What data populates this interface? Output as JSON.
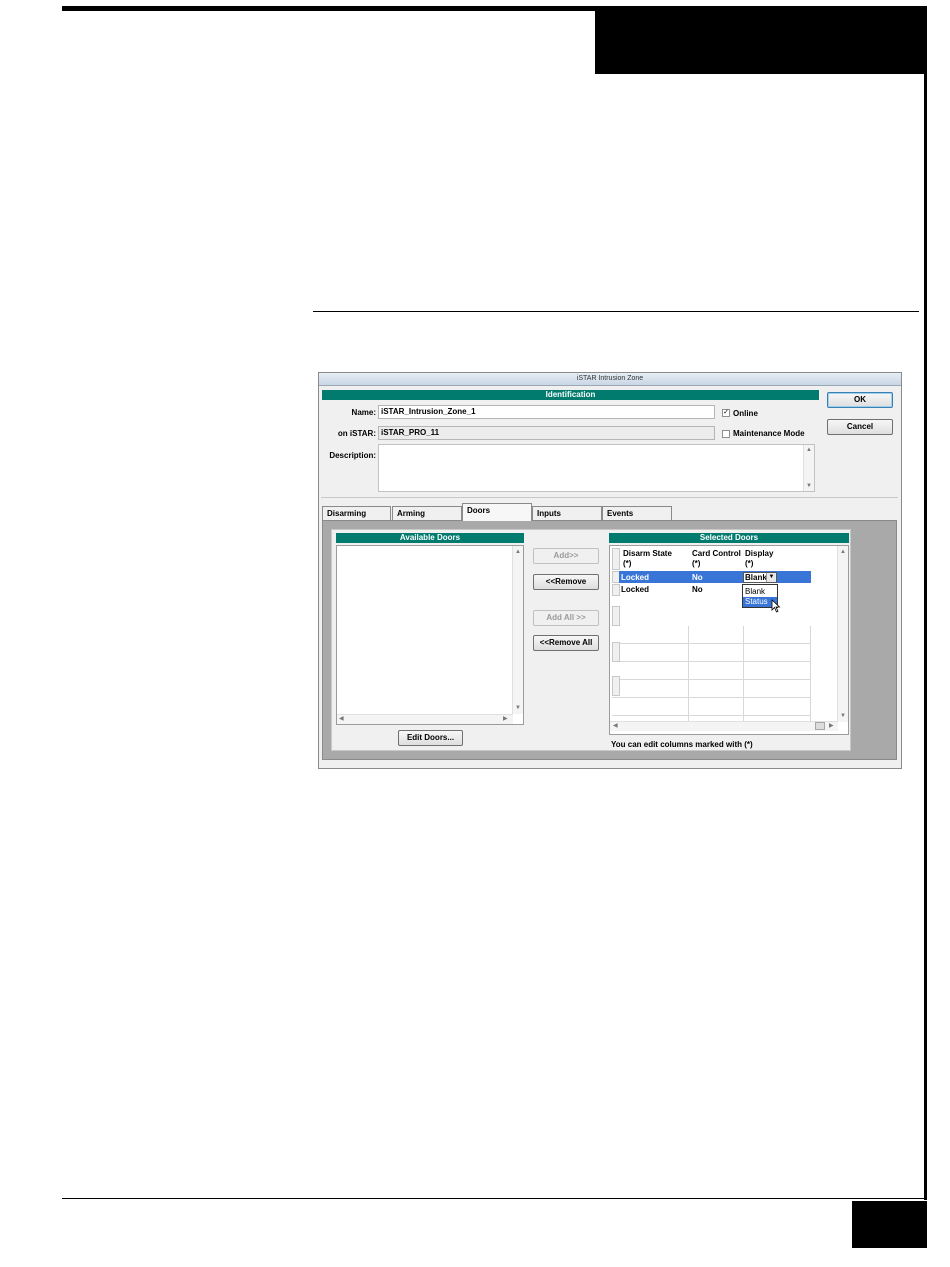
{
  "dialog": {
    "title": "iSTAR Intrusion Zone",
    "identification_header": "Identification",
    "name_label": "Name:",
    "name_value": "iSTAR_Intrusion_Zone_1",
    "on_istar_label": "on iSTAR:",
    "on_istar_value": "iSTAR_PRO_11",
    "description_label": "Description:",
    "description_value": "",
    "online_label": "Online",
    "online_checked": true,
    "maintenance_label": "Maintenance Mode",
    "maintenance_checked": false,
    "ok_label": "OK",
    "cancel_label": "Cancel"
  },
  "tabs": [
    {
      "label": "Disarming",
      "active": false
    },
    {
      "label": "Arming",
      "active": false
    },
    {
      "label": "Doors",
      "active": true
    },
    {
      "label": "Inputs",
      "active": false
    },
    {
      "label": "Events",
      "active": false
    }
  ],
  "doors": {
    "available_header": "Available Doors",
    "selected_header": "Selected Doors",
    "add_label": "Add>>",
    "remove_label": "<<Remove",
    "add_all_label": "Add All >>",
    "remove_all_label": "<<Remove All",
    "edit_doors_label": "Edit Doors...",
    "columns": [
      {
        "name": "Disarm State",
        "mark": "(*)"
      },
      {
        "name": "Card Control",
        "mark": "(*)"
      },
      {
        "name": "Display",
        "mark": "(*)"
      }
    ],
    "rows": [
      {
        "disarm_state": "Locked",
        "card_control": "No",
        "display": "Blank",
        "selected": true
      },
      {
        "disarm_state": "Locked",
        "card_control": "No",
        "display": "",
        "selected": false
      }
    ],
    "display_options": [
      "Blank",
      "Status"
    ],
    "hovered_option": "Status",
    "footer_note": "You can edit columns marked with (*)"
  },
  "colors": {
    "header_teal": "#007b6e",
    "selection_blue": "#3875d7"
  }
}
